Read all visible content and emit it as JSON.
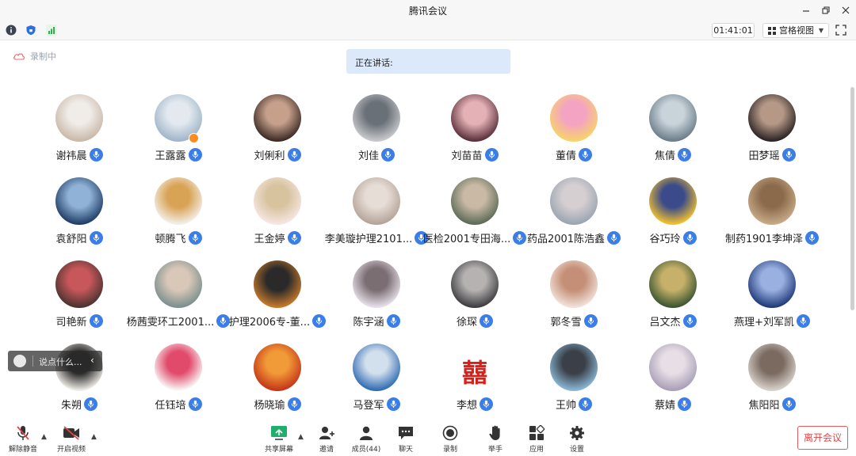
{
  "window": {
    "title": "腾讯会议"
  },
  "infobar": {
    "timer": "01:41:01",
    "view_label": "宫格视图"
  },
  "status": {
    "recording": "录制中",
    "speaking": "正在讲话:"
  },
  "chat": {
    "placeholder": "说点什么..."
  },
  "participants": [
    {
      "name": "谢祎晨"
    },
    {
      "name": "王露露"
    },
    {
      "name": "刘俐利"
    },
    {
      "name": "刘佳"
    },
    {
      "name": "刘苗苗"
    },
    {
      "name": "董倩"
    },
    {
      "name": "焦倩"
    },
    {
      "name": "田梦瑶"
    },
    {
      "name": "袁舒阳"
    },
    {
      "name": "顿腾飞"
    },
    {
      "name": "王金婷"
    },
    {
      "name": "李美璇护理2101..."
    },
    {
      "name": "医检2001专田海..."
    },
    {
      "name": "药品2001陈浩鑫"
    },
    {
      "name": "谷巧玲"
    },
    {
      "name": "制药1901李坤泽"
    },
    {
      "name": "司艳新"
    },
    {
      "name": "杨茜雯环工2001..."
    },
    {
      "name": "护理2006专-董..."
    },
    {
      "name": "陈宇涵"
    },
    {
      "name": "徐琛"
    },
    {
      "name": "郭冬雪"
    },
    {
      "name": "吕文杰"
    },
    {
      "name": "燕理+刘军凯"
    },
    {
      "name": "朱朔"
    },
    {
      "name": "任钰培"
    },
    {
      "name": "杨晓瑜"
    },
    {
      "name": "马登军"
    },
    {
      "name": "李想",
      "avatar_text": "囍"
    },
    {
      "name": "王帅"
    },
    {
      "name": "蔡婧"
    },
    {
      "name": "焦阳阳"
    }
  ],
  "toolbar": {
    "unmute": "解除静音",
    "start_video": "开启视频",
    "share_screen": "共享屏幕",
    "invite": "邀请",
    "members": "成员(44)",
    "chat": "聊天",
    "record": "录制",
    "raise_hand": "举手",
    "apps": "应用",
    "settings": "设置",
    "leave": "离开会议"
  },
  "colors": {
    "accent": "#3b7ee9",
    "speaking_bg": "#dbe9fb",
    "leave": "#e04545"
  }
}
